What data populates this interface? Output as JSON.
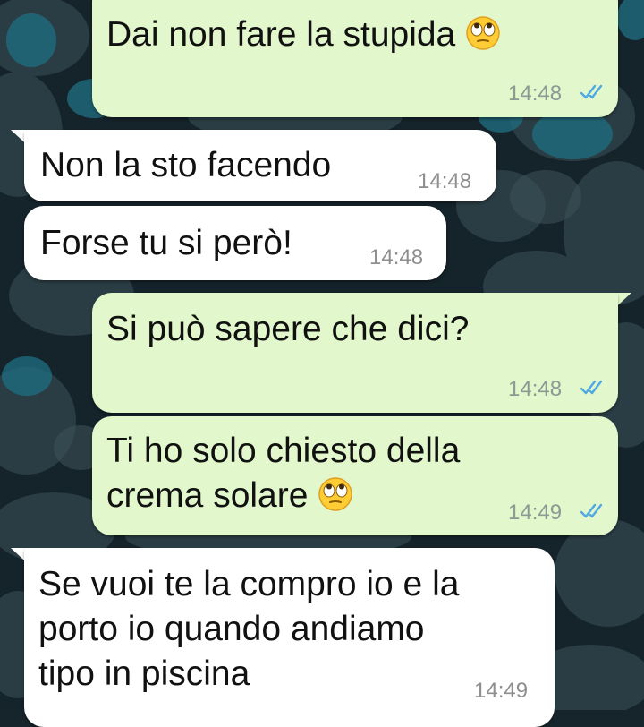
{
  "conversation": {
    "messages": [
      {
        "direction": "outgoing",
        "text": "Dai non fare la stupida",
        "emoji": "face-with-rolling-eyes",
        "time": "14:48",
        "status": "read"
      },
      {
        "direction": "incoming",
        "text": "Non la sto facendo",
        "time": "14:48"
      },
      {
        "direction": "incoming",
        "text": "Forse tu si però!",
        "time": "14:48"
      },
      {
        "direction": "outgoing",
        "text": "Si può sapere che dici?",
        "time": "14:48",
        "status": "read"
      },
      {
        "direction": "outgoing",
        "lines": [
          "Ti ho solo chiesto della",
          "crema solare"
        ],
        "emoji": "face-with-rolling-eyes",
        "time": "14:49",
        "status": "read"
      },
      {
        "direction": "incoming",
        "lines": [
          "Se vuoi te la compro io e la",
          "porto io quando andiamo",
          "tipo in piscina"
        ],
        "time": "14:49"
      }
    ]
  },
  "colors": {
    "outgoing_bubble": "#e2f7cb",
    "incoming_bubble": "#ffffff",
    "read_ticks": "#4fa9e6",
    "wallpaper": "#16252b"
  }
}
